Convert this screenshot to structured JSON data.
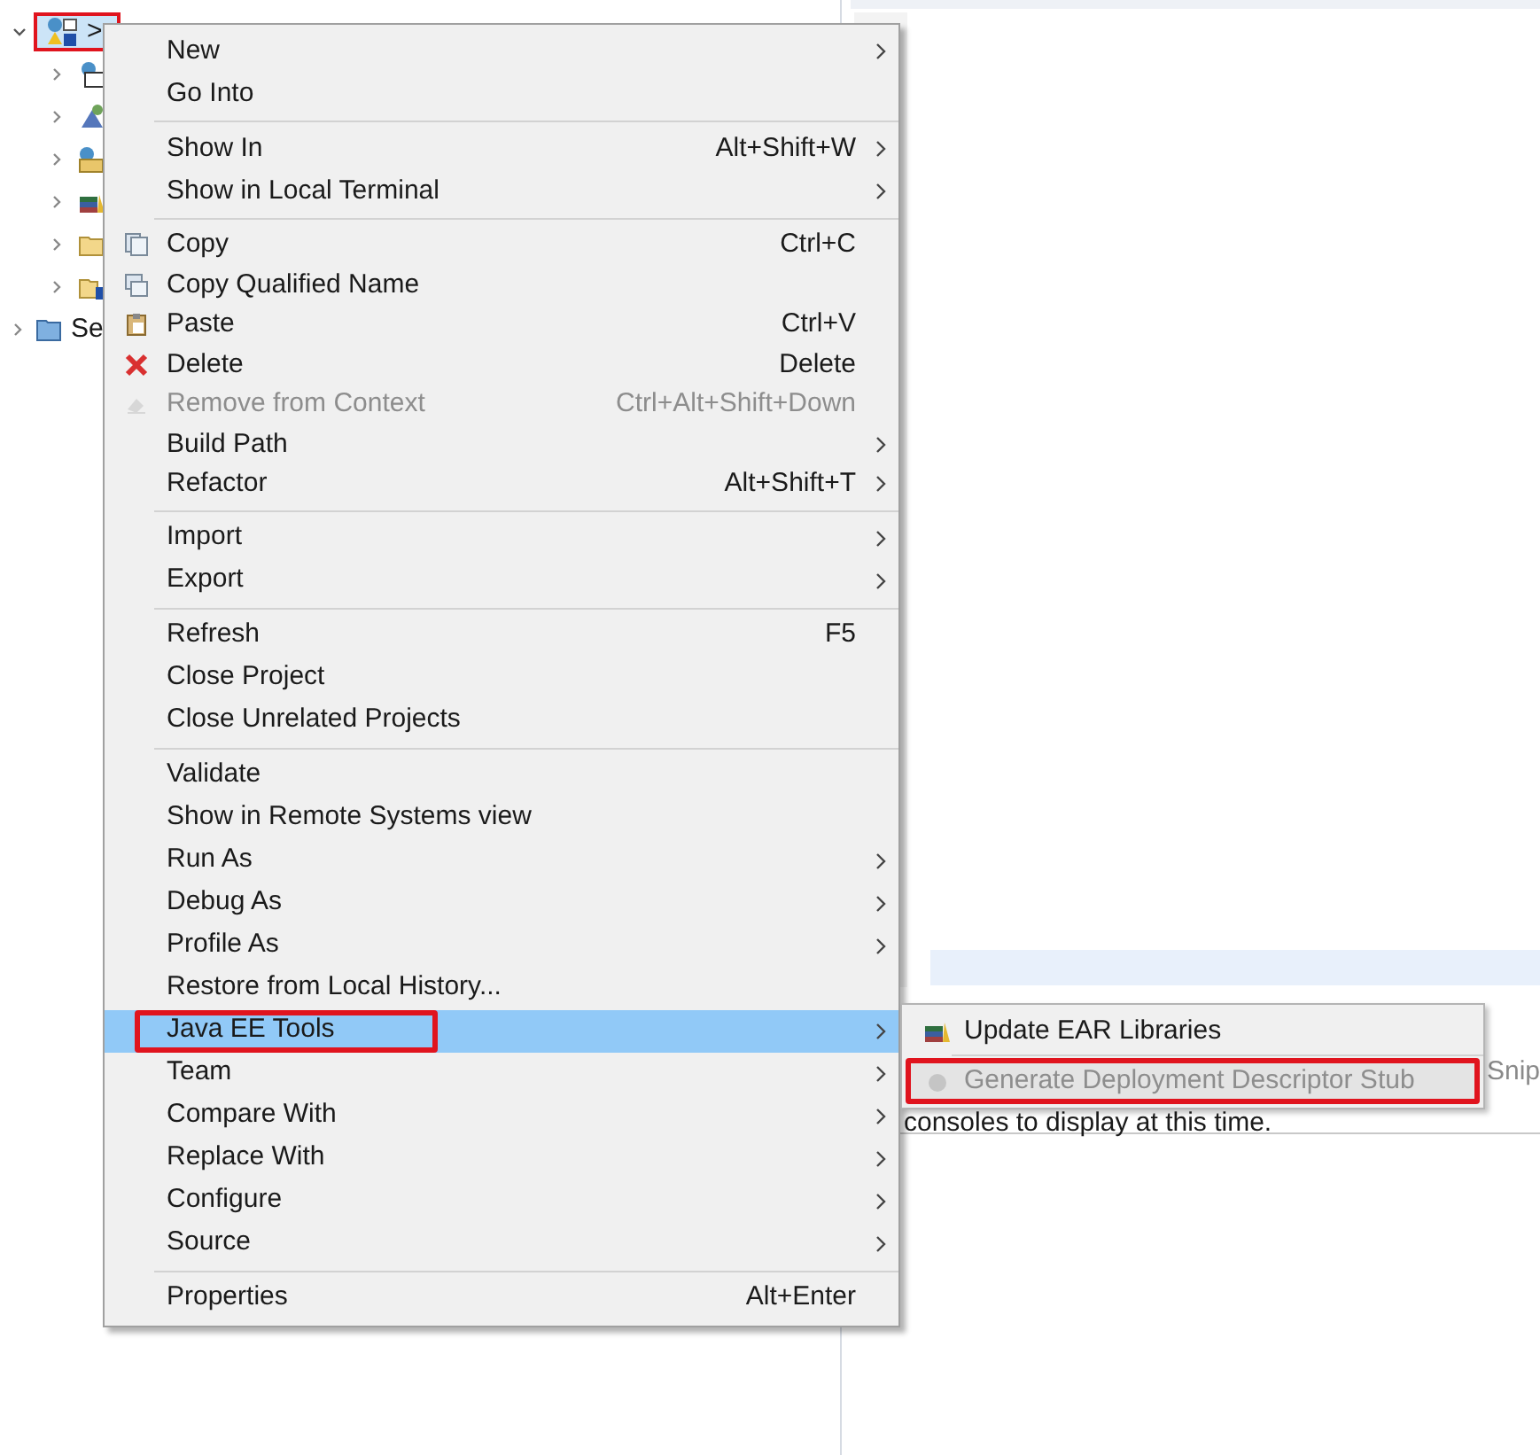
{
  "tree": {
    "root": {
      "label": ">",
      "expanded": true,
      "selected": true,
      "children": [
        {
          "kind": "jar",
          "expanded": false
        },
        {
          "kind": "server",
          "expanded": false
        },
        {
          "kind": "webfolder",
          "expanded": false
        },
        {
          "kind": "library",
          "expanded": false
        },
        {
          "kind": "folder",
          "expanded": false
        },
        {
          "kind": "unknownfolder",
          "expanded": false
        }
      ]
    },
    "next": {
      "label": "Se",
      "expanded": false
    }
  },
  "console": {
    "message": "consoles to display at this time.",
    "tab_fragment": "Snip"
  },
  "menu": {
    "sections": [
      [
        {
          "label": "New",
          "submenu": true,
          "disabled": false,
          "selected": false
        },
        {
          "label": "Go Into",
          "submenu": false,
          "disabled": false,
          "selected": false
        }
      ],
      [
        {
          "label": "Show In",
          "shortcut": "Alt+Shift+W",
          "submenu": true,
          "disabled": false,
          "selected": false
        },
        {
          "label": "Show in Local Terminal",
          "submenu": true,
          "disabled": false,
          "selected": false
        }
      ],
      [
        {
          "label": "Copy",
          "kind": "copy",
          "shortcut": "Ctrl+C",
          "submenu": false,
          "disabled": false,
          "selected": false
        },
        {
          "label": "Copy Qualified Name",
          "kind": "copy2",
          "submenu": false,
          "disabled": false,
          "selected": false
        },
        {
          "label": "Paste",
          "kind": "paste",
          "shortcut": "Ctrl+V",
          "submenu": false,
          "disabled": false,
          "selected": false
        },
        {
          "label": "Delete",
          "kind": "delete",
          "shortcut": "Delete",
          "submenu": false,
          "disabled": false,
          "selected": false
        },
        {
          "label": "Remove from Context",
          "kind": "context",
          "shortcut": "Ctrl+Alt+Shift+Down",
          "submenu": false,
          "disabled": true,
          "selected": false
        },
        {
          "label": "Build Path",
          "submenu": true,
          "disabled": false,
          "selected": false
        },
        {
          "label": "Refactor",
          "shortcut": "Alt+Shift+T",
          "submenu": true,
          "disabled": false,
          "selected": false
        }
      ],
      [
        {
          "label": "Import",
          "submenu": true,
          "disabled": false,
          "selected": false
        },
        {
          "label": "Export",
          "submenu": true,
          "disabled": false,
          "selected": false
        }
      ],
      [
        {
          "label": "Refresh",
          "shortcut": "F5",
          "submenu": false,
          "disabled": false,
          "selected": false
        },
        {
          "label": "Close Project",
          "submenu": false,
          "disabled": false,
          "selected": false
        },
        {
          "label": "Close Unrelated Projects",
          "submenu": false,
          "disabled": false,
          "selected": false
        }
      ],
      [
        {
          "label": "Validate",
          "submenu": false,
          "disabled": false,
          "selected": false
        },
        {
          "label": "Show in Remote Systems view",
          "submenu": false,
          "disabled": false,
          "selected": false
        },
        {
          "label": "Run As",
          "submenu": true,
          "disabled": false,
          "selected": false
        },
        {
          "label": "Debug As",
          "submenu": true,
          "disabled": false,
          "selected": false
        },
        {
          "label": "Profile As",
          "submenu": true,
          "disabled": false,
          "selected": false
        },
        {
          "label": "Restore from Local History...",
          "submenu": false,
          "disabled": false,
          "selected": false
        },
        {
          "label": "Java EE Tools",
          "submenu": true,
          "disabled": false,
          "selected": true,
          "highlighted": true
        },
        {
          "label": "Team",
          "submenu": true,
          "disabled": false,
          "selected": false
        },
        {
          "label": "Compare With",
          "submenu": true,
          "disabled": false,
          "selected": false
        },
        {
          "label": "Replace With",
          "submenu": true,
          "disabled": false,
          "selected": false
        },
        {
          "label": "Configure",
          "submenu": true,
          "disabled": false,
          "selected": false
        },
        {
          "label": "Source",
          "submenu": true,
          "disabled": false,
          "selected": false
        }
      ],
      [
        {
          "label": "Properties",
          "shortcut": "Alt+Enter",
          "submenu": false,
          "disabled": false,
          "selected": false
        }
      ]
    ]
  },
  "submenu": {
    "items": [
      {
        "label": "Update EAR Libraries",
        "kind": "library",
        "disabled": false,
        "highlighted": false
      },
      {
        "label": "Generate Deployment Descriptor Stub",
        "kind": "stub",
        "disabled": true,
        "highlighted": true
      }
    ]
  }
}
